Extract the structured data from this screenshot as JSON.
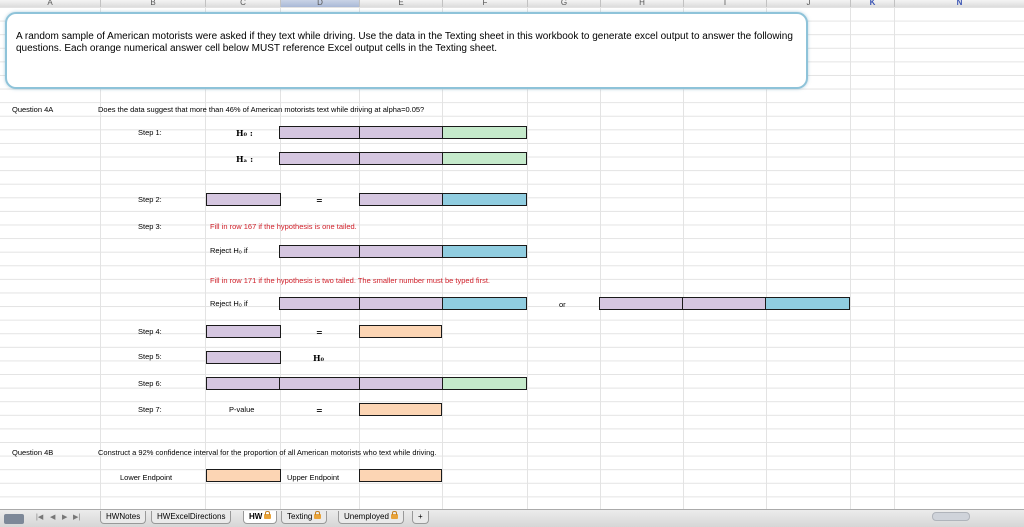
{
  "columns": [
    "A",
    "B",
    "C",
    "D",
    "E",
    "F",
    "G",
    "H",
    "I",
    "J",
    "K",
    "N"
  ],
  "intro": "A random sample of American motorists were asked if they text while driving.  Use the data in the Texting sheet in this workbook to generate excel output to answer the following questions.  Each orange numerical answer cell below MUST reference Excel output cells in the Texting sheet.",
  "q4a": {
    "label": "Question 4A",
    "question": "Does the data suggest that more than 46% of American motorists text while driving at alpha=0.05?",
    "step1": "Step 1:",
    "h0": "H₀ :",
    "ha": "Hₐ :",
    "step2": "Step 2:",
    "eq": "=",
    "step3": "Step 3:",
    "note1": "Fill in row 167 if the hypothesis is one tailed.",
    "reject1": "Reject H₀ if",
    "note2": "Fill in row 171 if the hypothesis is two tailed. The smaller number must be typed first.",
    "reject2": "Reject H₀ if",
    "or": "or",
    "step4": "Step 4:",
    "step5": "Step 5:",
    "h0b": "H₀",
    "step6": "Step 6:",
    "step7": "Step 7:",
    "pvalue": "P-value"
  },
  "q4b": {
    "label": "Question 4B",
    "question": "Construct a 92% confidence interval for the proportion of all American motorists who text while driving.",
    "lower": "Lower Endpoint",
    "upper": "Upper Endpoint"
  },
  "tabs": [
    "HWNotes",
    "HWExcelDirections",
    "HW",
    "Texting",
    "Unemployed",
    "+"
  ],
  "active_tab": "HW",
  "colors": {
    "lavender": "#d5c6e0",
    "green": "#c5eacb",
    "blue": "#90cde0",
    "orange": "#fcd5b4",
    "red": "#d0202a"
  }
}
